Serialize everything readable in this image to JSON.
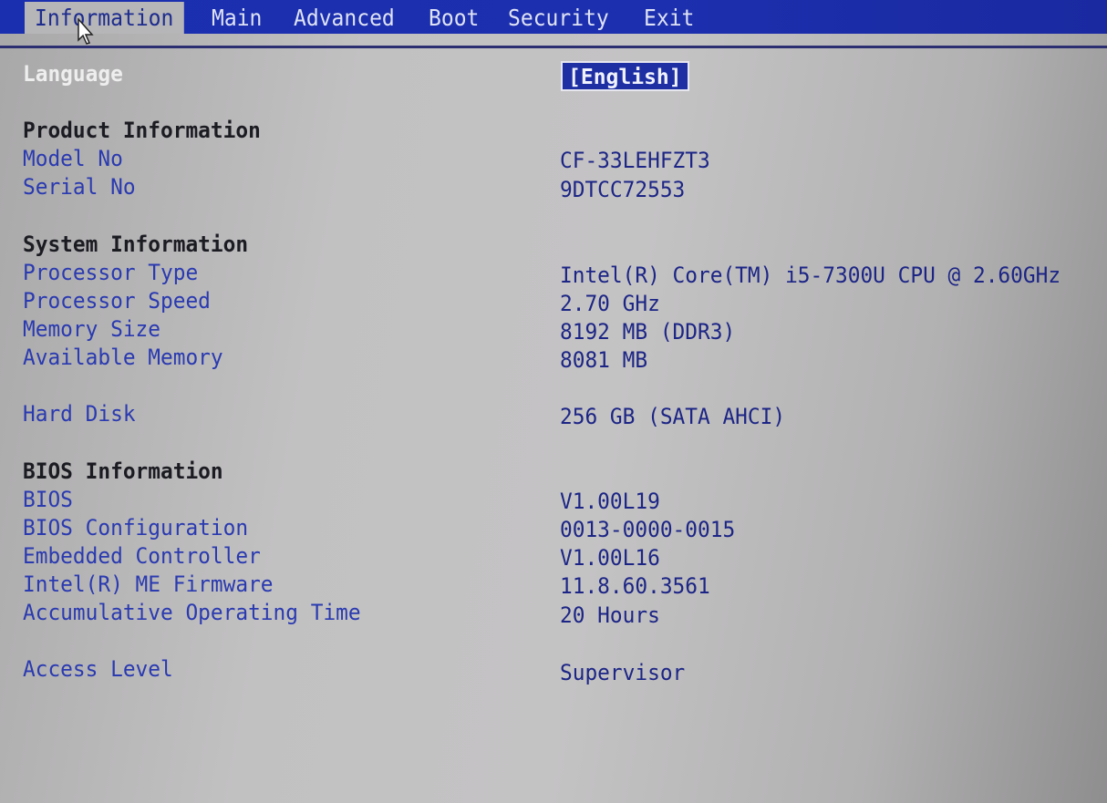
{
  "menu": {
    "tabs": [
      "Information",
      "Main",
      "Advanced",
      "Boot",
      "Security",
      "Exit"
    ],
    "active": "Information"
  },
  "language": {
    "label": "Language",
    "value": "[English]"
  },
  "product": {
    "heading": "Product Information",
    "rows": [
      {
        "label": "Model No",
        "value": "CF-33LEHFZT3"
      },
      {
        "label": "Serial No",
        "value": "9DTCC72553"
      }
    ]
  },
  "system": {
    "heading": "System Information",
    "rows": [
      {
        "label": "Processor Type",
        "value": "Intel(R) Core(TM) i5-7300U CPU @ 2.60GHz"
      },
      {
        "label": "Processor Speed",
        "value": "2.70 GHz"
      },
      {
        "label": "Memory Size",
        "value": "8192 MB (DDR3)"
      },
      {
        "label": "Available Memory",
        "value": "8081 MB"
      }
    ]
  },
  "disk": {
    "label": "Hard Disk",
    "value": "256 GB (SATA AHCI)"
  },
  "bios": {
    "heading": "BIOS Information",
    "rows": [
      {
        "label": "BIOS",
        "value": "V1.00L19"
      },
      {
        "label": "BIOS Configuration",
        "value": "0013-0000-0015"
      },
      {
        "label": "Embedded Controller",
        "value": "V1.00L16"
      },
      {
        "label": "Intel(R) ME Firmware",
        "value": "11.8.60.3561"
      },
      {
        "label": "Accumulative Operating Time",
        "value": "20 Hours"
      }
    ]
  },
  "access": {
    "label": "Access Level",
    "value": "Supervisor"
  },
  "colors": {
    "menu_bg": "#1a2fb0",
    "label": "#2a3ab0",
    "value": "#1c2585",
    "heading": "#1b1b22",
    "selected_bg": "#1d2fa2"
  }
}
